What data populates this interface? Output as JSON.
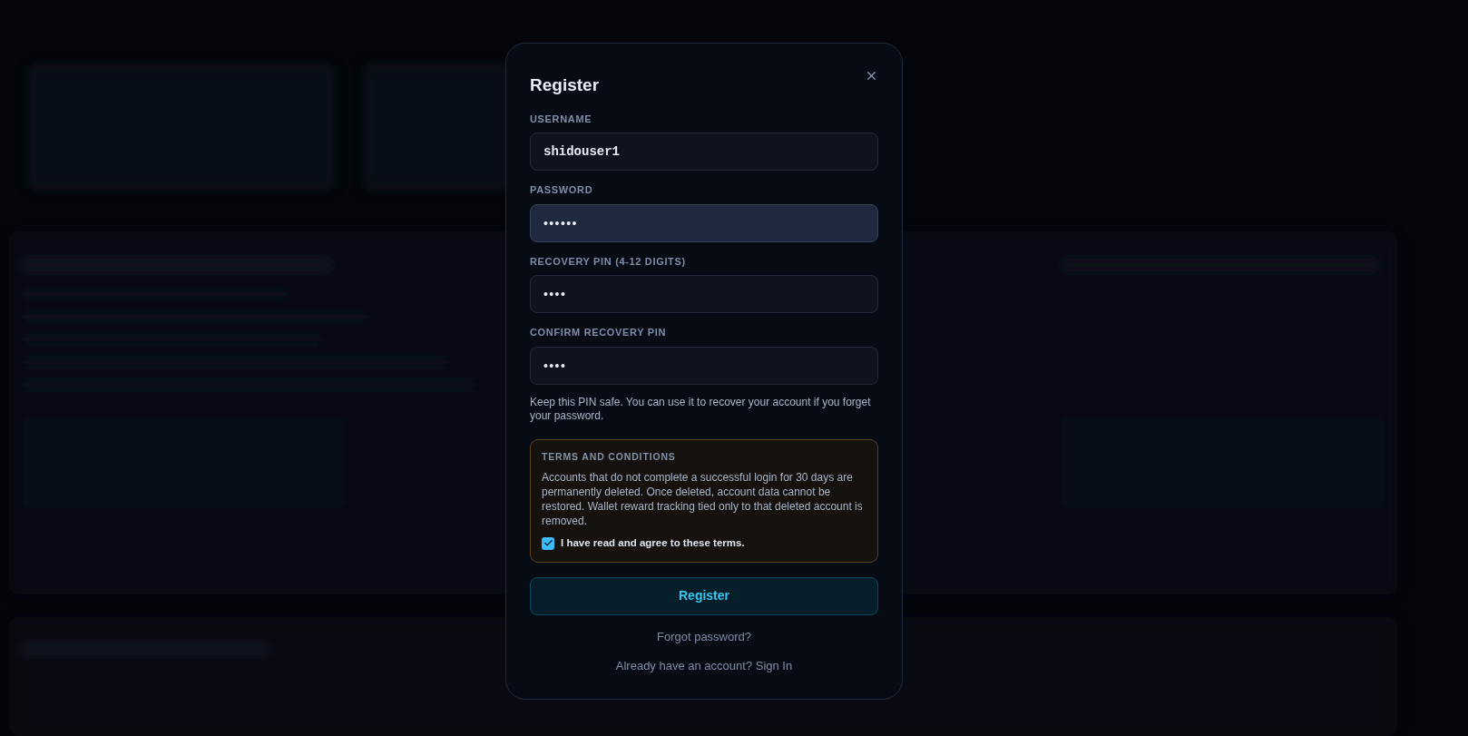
{
  "dialog": {
    "title": "Register",
    "fields": [
      {
        "label": "USERNAME",
        "value": "shidouser1",
        "kind": "text",
        "focused": false
      },
      {
        "label": "PASSWORD",
        "value": "••••••",
        "kind": "masked",
        "focused": true
      },
      {
        "label": "RECOVERY PIN (4-12 DIGITS)",
        "value": "••••",
        "kind": "masked",
        "focused": false
      },
      {
        "label": "CONFIRM RECOVERY PIN",
        "value": "••••",
        "kind": "masked",
        "focused": false
      }
    ],
    "hint": "Keep this PIN safe. You can use it to recover your account if you forget your password.",
    "terms": {
      "title": "TERMS AND CONDITIONS",
      "body": "Accounts that do not complete a successful login for 30 days are permanently deleted. Once deleted, account data cannot be restored. Wallet reward tracking tied only to that deleted account is removed.",
      "agree_label": "I have read and agree to these terms.",
      "checked": true
    },
    "submit": "Register",
    "forgot_link": "Forgot password?",
    "signin_link": "Already have an account? Sign In"
  }
}
